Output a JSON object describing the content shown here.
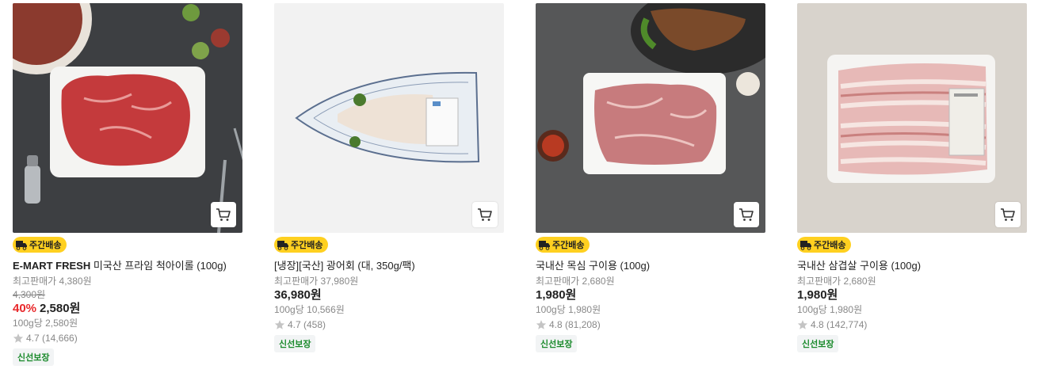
{
  "products": [
    {
      "badge": "주간배송",
      "brand": "E-MART FRESH",
      "name": " 미국산 프라임 척아이롤 (100g)",
      "max_price": "최고판매가 4,380원",
      "original_price": "4,300원",
      "discount": "40%",
      "price": "2,580원",
      "unit_price": "100g당 2,580원",
      "rating": "4.7 (14,666)",
      "fresh": "신선보장"
    },
    {
      "badge": "주간배송",
      "brand": "",
      "name": "[냉장][국산] 광어회 (대, 350g/팩)",
      "max_price": "최고판매가 37,980원",
      "price": "36,980원",
      "unit_price": "100g당 10,566원",
      "rating": "4.7 (458)",
      "fresh": "신선보장"
    },
    {
      "badge": "주간배송",
      "brand": "",
      "name": "국내산 목심 구이용 (100g)",
      "max_price": "최고판매가 2,680원",
      "price": "1,980원",
      "unit_price": "100g당 1,980원",
      "rating": "4.8 (81,208)",
      "fresh": "신선보장"
    },
    {
      "badge": "주간배송",
      "brand": "",
      "name": "국내산 삼겹살 구이용 (100g)",
      "max_price": "최고판매가 2,680원",
      "price": "1,980원",
      "unit_price": "100g당 1,980원",
      "rating": "4.8 (142,774)",
      "fresh": "신선보장"
    }
  ],
  "colors": {
    "discount": "#e8282b",
    "badge_bg": "#ffd020",
    "fresh_text": "#1a8a2b"
  }
}
